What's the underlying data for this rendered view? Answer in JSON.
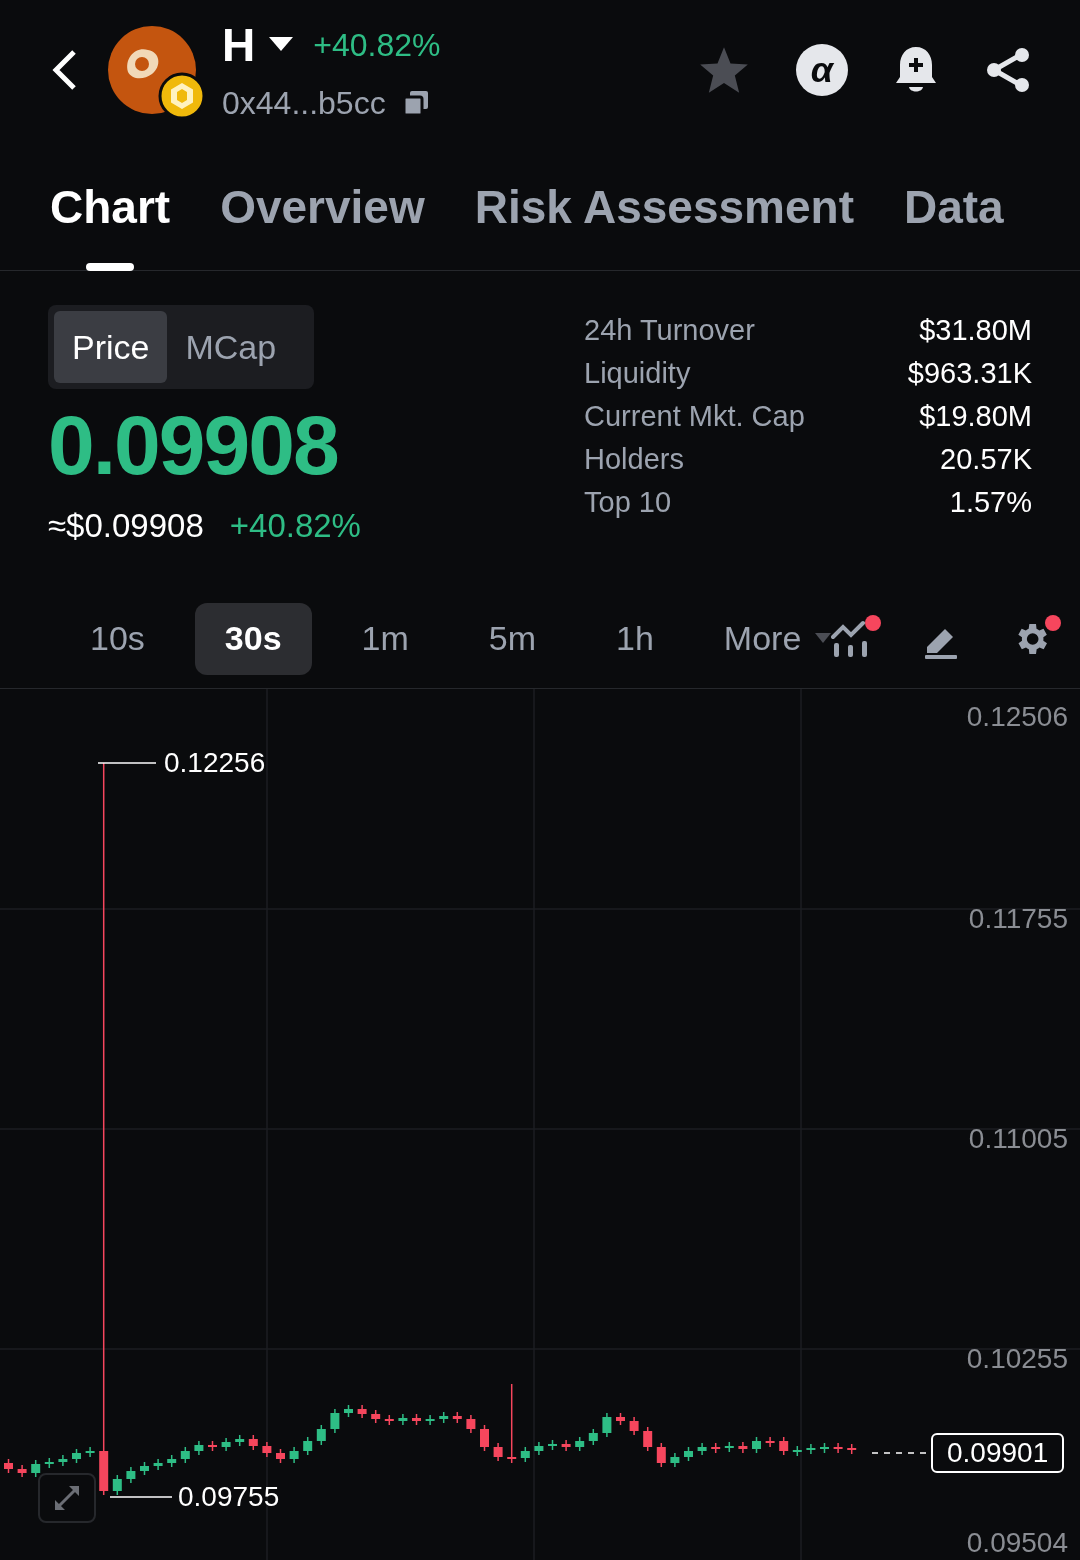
{
  "header": {
    "symbol": "H",
    "change": "+40.82%",
    "address": "0x44...b5cc",
    "alpha_badge": "α",
    "favorite": false
  },
  "tabs": [
    {
      "label": "Chart",
      "selected": true
    },
    {
      "label": "Overview",
      "selected": false
    },
    {
      "label": "Risk Assessment",
      "selected": false
    },
    {
      "label": "Data",
      "selected": false
    }
  ],
  "mode_toggle": [
    {
      "label": "Price",
      "selected": true
    },
    {
      "label": "MCap",
      "selected": false
    }
  ],
  "price": "0.09908",
  "usd_price": "≈$0.09908",
  "price_change": "+40.82%",
  "stats": [
    {
      "label": "24h Turnover",
      "value": "$31.80M"
    },
    {
      "label": "Liquidity",
      "value": "$963.31K"
    },
    {
      "label": "Current Mkt. Cap",
      "value": "$19.80M"
    },
    {
      "label": "Holders",
      "value": "20.57K"
    },
    {
      "label": "Top 10",
      "value": "1.57%"
    }
  ],
  "intervals": [
    {
      "label": "10s",
      "selected": false
    },
    {
      "label": "30s",
      "selected": true
    },
    {
      "label": "1m",
      "selected": false
    },
    {
      "label": "5m",
      "selected": false
    },
    {
      "label": "1h",
      "selected": false
    }
  ],
  "more_label": "More",
  "tools": [
    {
      "kind": "indicators",
      "dot": true
    },
    {
      "kind": "draw",
      "dot": false
    },
    {
      "kind": "settings",
      "dot": true
    }
  ],
  "chart": {
    "price_axis": [
      "0.12506",
      "0.11755",
      "0.11005",
      "0.10255",
      "0.09504"
    ],
    "high_label": "0.12256",
    "low_label": "0.09755",
    "last_price": "0.09901"
  }
}
